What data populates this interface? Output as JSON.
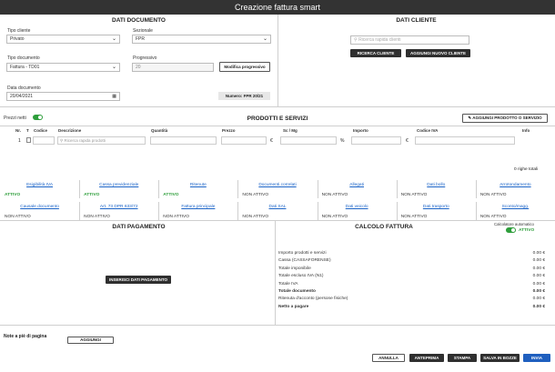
{
  "window": {
    "title": "Creazione fattura smart"
  },
  "documento": {
    "heading": "DATI DOCUMENTO",
    "tipo_cliente_label": "Tipo cliente",
    "tipo_cliente_value": "Privato",
    "sezionale_label": "Sezionale",
    "sezionale_value": "FPR",
    "tipo_documento_label": "Tipo documento",
    "tipo_documento_value": "Fattura - TD01",
    "progressivo_label": "Progressivo",
    "progressivo_value": "20",
    "modifica_button": "Modifica progressivo",
    "data_label": "Data documento",
    "data_value": "20/04/2021",
    "numero_badge": "Numero: FPR 20/21"
  },
  "cliente": {
    "heading": "DATI CLIENTE",
    "search_placeholder": "Ricerca rapida clienti",
    "ricerca_button": "RICERCA CLIENTE",
    "aggiungi_button": "AGGIUNGI NUOVO CLIENTE"
  },
  "prodotti": {
    "prezzi_netti_label": "Prezzi netti",
    "heading": "PRODOTTI E SERVIZI",
    "aggiungi_button": "AGGIUNGI PRODOTTO O SERVIZIO",
    "columns": {
      "nr": "Nr.",
      "t": "T",
      "codice": "Codice",
      "descrizione": "Descrizione",
      "quantita": "Quantità",
      "prezzo": "Prezzo",
      "sc_mg": "Sc / Mg",
      "importo": "Importo",
      "codice_iva": "Codice IVA",
      "info": "Info"
    },
    "row": {
      "nr": "1",
      "descrizione_placeholder": "Ricerca rapida prodotti",
      "euro1": "€",
      "percent": "%",
      "euro2": "€"
    },
    "righe_totali": "0 righe totali"
  },
  "opzioni": {
    "row1": [
      {
        "label": "Esigibilità IVA",
        "status": "ATTIVO",
        "active": true
      },
      {
        "label": "Cassa previdenziale",
        "status": "ATTIVO",
        "active": true
      },
      {
        "label": "Ritenute",
        "status": "ATTIVO",
        "active": true
      },
      {
        "label": "Documenti correlati",
        "status": "NON ATTIVO",
        "active": false
      },
      {
        "label": "Allegati",
        "status": "NON ATTIVO",
        "active": false
      },
      {
        "label": "Dati bollo",
        "status": "NON ATTIVO",
        "active": false
      },
      {
        "label": "Arrotondamento",
        "status": "NON ATTIVO",
        "active": false
      }
    ],
    "row2": [
      {
        "label": "Causale documento",
        "status": "NON ATTIVO",
        "active": false
      },
      {
        "label": "Art. 73 DPR 633/72",
        "status": "NON ATTIVO",
        "active": false
      },
      {
        "label": "Fattura principale",
        "status": "NON ATTIVO",
        "active": false
      },
      {
        "label": "Dati SAL",
        "status": "NON ATTIVO",
        "active": false
      },
      {
        "label": "Dati veicolo",
        "status": "NON ATTIVO",
        "active": false
      },
      {
        "label": "Dati trasporto",
        "status": "NON ATTIVO",
        "active": false
      },
      {
        "label": "Sconto/magg.",
        "status": "NON ATTIVO",
        "active": false
      }
    ]
  },
  "pagamento": {
    "heading": "DATI PAGAMENTO",
    "inserisci_button": "INSERISCI DATI PAGAMENTO"
  },
  "calcolo": {
    "heading": "CALCOLO FATTURA",
    "auto_label": "Calcolatore automatico",
    "auto_status": "ATTIVO",
    "rows": [
      {
        "label": "Importo prodotti e servizi",
        "value": "0.00 €",
        "bold": false
      },
      {
        "label": "Cassa (CASSAFORENSE)",
        "value": "0.00 €",
        "bold": false
      },
      {
        "label": "Totale imponibile",
        "value": "0.00 €",
        "bold": false
      },
      {
        "label": "Totale escluso IVA (N1)",
        "value": "0.00 €",
        "bold": false
      },
      {
        "label": "Totale IVA",
        "value": "0.00 €",
        "bold": false
      },
      {
        "label": "Totale documento",
        "value": "0.00 €",
        "bold": true
      },
      {
        "label": "Ritenuta d'acconto (persone fisiche)",
        "value": "0.00 €",
        "bold": false
      },
      {
        "label": "Netto a pagare",
        "value": "0.00 €",
        "bold": true
      }
    ]
  },
  "note": {
    "label": "Note a piè di pagina",
    "aggiungi_button": "AGGIUNGI"
  },
  "footer": {
    "annulla": "ANNULLA",
    "anteprima": "ANTEPRIMA",
    "stampa": "STAMPA",
    "salva_bozze": "SALVA IN BOZZE",
    "invia": "INVIA"
  },
  "colors": {
    "accent_green": "#2e9e3b",
    "link_blue": "#1a63c7",
    "invia_blue": "#1f5fbf",
    "dark": "#2f2f2f"
  }
}
